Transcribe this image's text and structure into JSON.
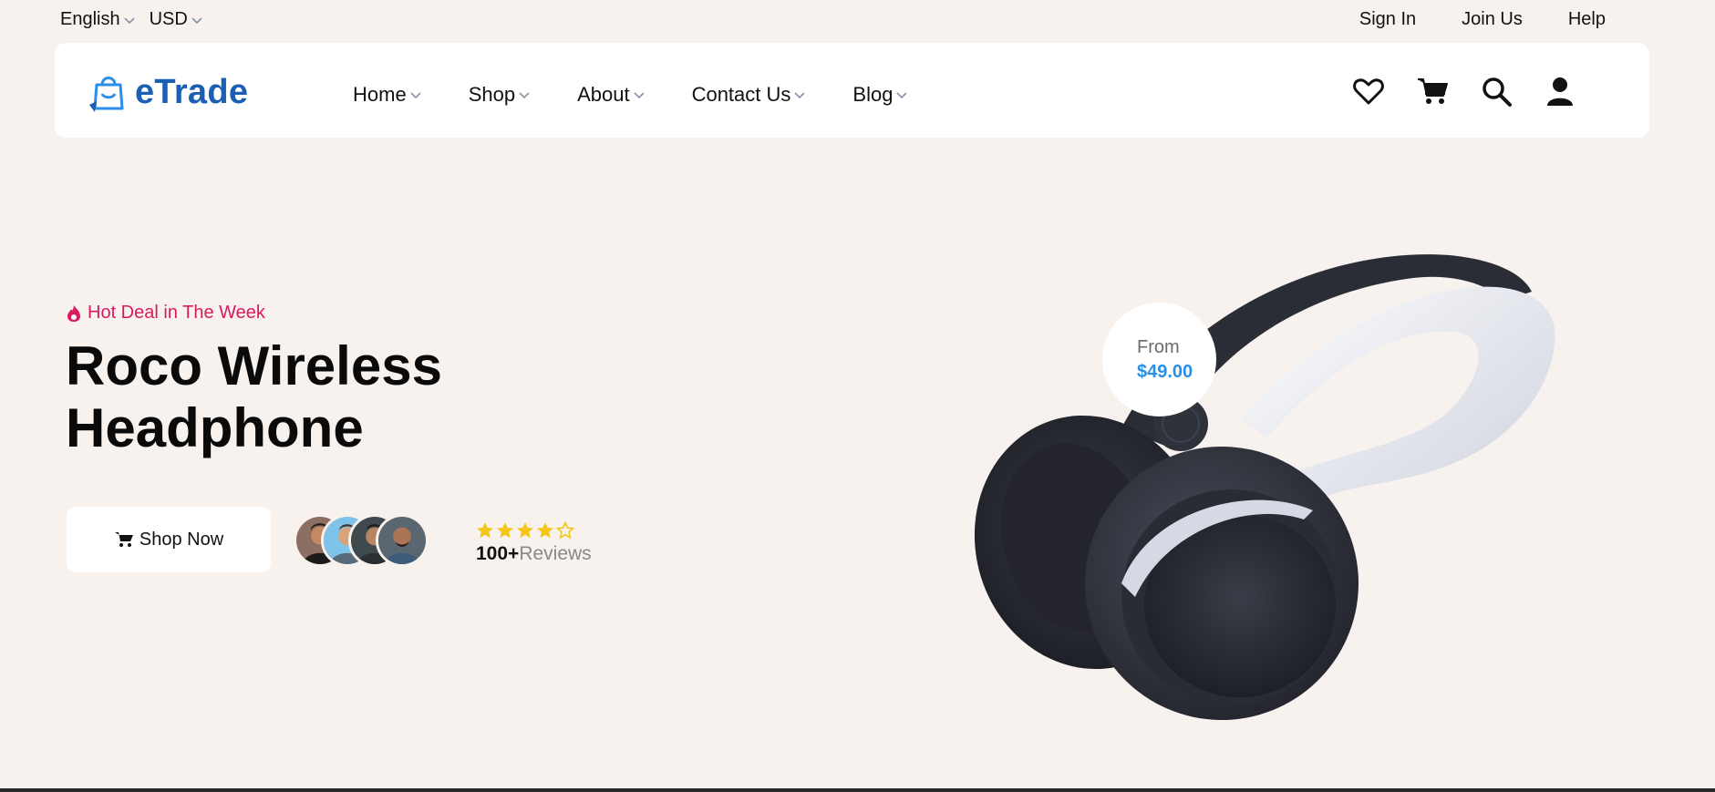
{
  "topbar": {
    "language": "English",
    "currency": "USD",
    "links": [
      "Sign In",
      "Join Us",
      "Help"
    ]
  },
  "header": {
    "brand": "eTrade",
    "nav": [
      "Home",
      "Shop",
      "About",
      "Contact Us",
      "Blog"
    ],
    "icons": [
      "heart-icon",
      "cart-icon",
      "search-icon",
      "user-icon"
    ]
  },
  "hero": {
    "tag": "Hot Deal in The Week",
    "title_line1": "Roco Wireless",
    "title_line2": "Headphone",
    "cta_label": "Shop Now",
    "rating_stars": 4,
    "rating_max": 5,
    "reviews_count": "100+",
    "reviews_label": "Reviews",
    "price_from_label": "From",
    "price_value": "$49.00"
  },
  "colors": {
    "background": "#f7f2ee",
    "brand": "#1a5fb4",
    "hot": "#d81b60",
    "price": "#2b8fe8",
    "star": "#f5c518"
  }
}
